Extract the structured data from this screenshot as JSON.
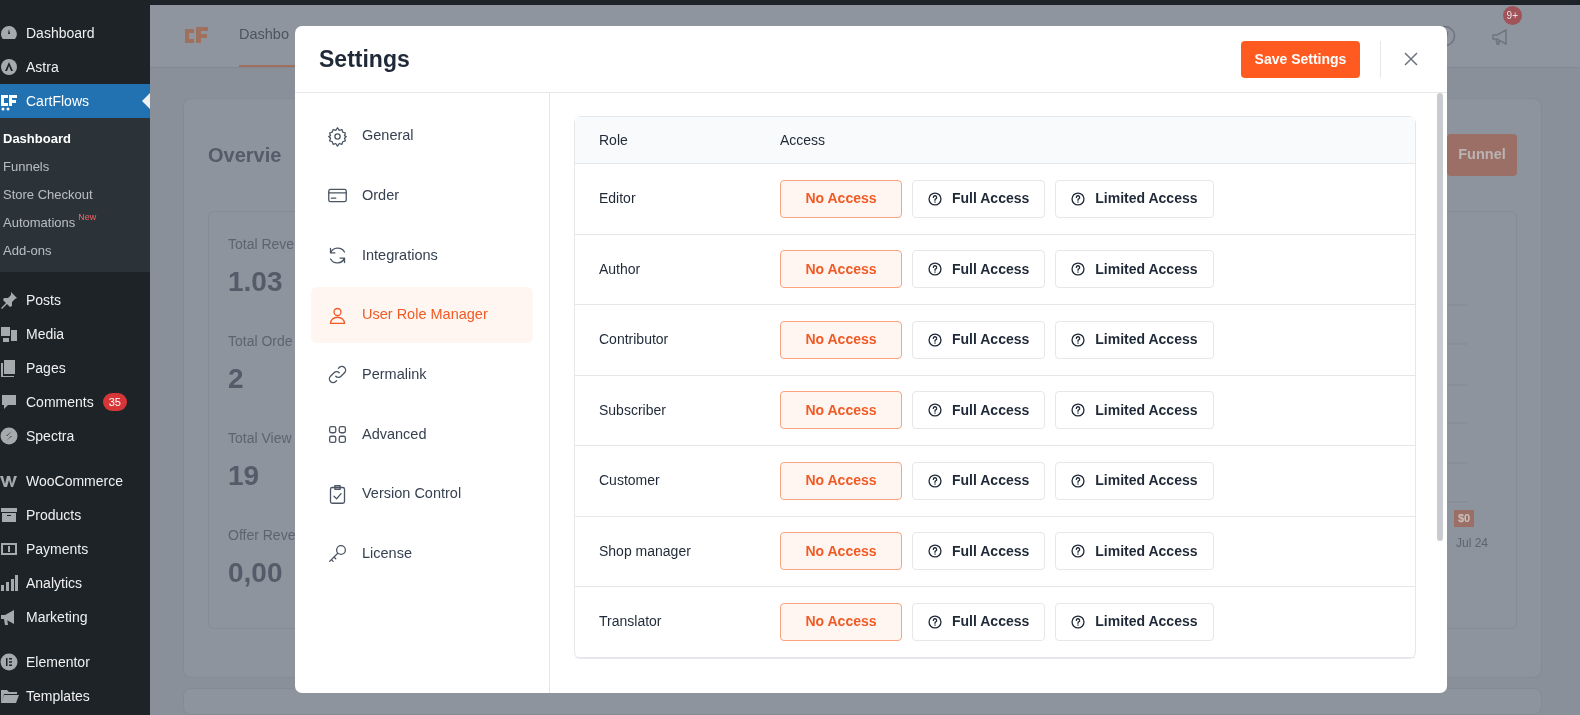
{
  "sidebar": {
    "groups": [
      [
        {
          "label": "Dashboard",
          "selected": false
        },
        {
          "label": "Astra",
          "selected": false
        },
        {
          "label": "CartFlows",
          "selected": true,
          "submenu": [
            {
              "label": "Dashboard",
              "selected": true
            },
            {
              "label": "Funnels",
              "selected": false
            },
            {
              "label": "Store Checkout",
              "selected": false
            },
            {
              "label": "Automations",
              "selected": false,
              "tag": "New"
            },
            {
              "label": "Add-ons",
              "selected": false
            }
          ]
        }
      ],
      [
        {
          "label": "Posts",
          "selected": false
        },
        {
          "label": "Media",
          "selected": false
        },
        {
          "label": "Pages",
          "selected": false
        },
        {
          "label": "Comments",
          "selected": false,
          "badge": "35"
        },
        {
          "label": "Spectra",
          "selected": false
        }
      ],
      [
        {
          "label": "WooCommerce",
          "selected": false
        },
        {
          "label": "Products",
          "selected": false
        },
        {
          "label": "Payments",
          "selected": false
        },
        {
          "label": "Analytics",
          "selected": false
        },
        {
          "label": "Marketing",
          "selected": false
        }
      ],
      [
        {
          "label": "Elementor",
          "selected": false
        },
        {
          "label": "Templates",
          "selected": false
        }
      ]
    ]
  },
  "background": {
    "header": {
      "tab": "Dashbo",
      "notification_badge": "9+"
    },
    "overview": {
      "title": "Overvie",
      "button": "Funnel",
      "stats": [
        {
          "label": "Total Reve",
          "value": "1.03"
        },
        {
          "label": "Total Orde",
          "value": "2"
        },
        {
          "label": "Total View",
          "value": "19"
        },
        {
          "label": "Offer Reve",
          "value": "0,00"
        }
      ],
      "chart_tag": "$0",
      "chart_date": "Jul 24"
    }
  },
  "modal": {
    "title": "Settings",
    "save_button": "Save Settings",
    "nav": [
      {
        "label": "General",
        "selected": false
      },
      {
        "label": "Order",
        "selected": false
      },
      {
        "label": "Integrations",
        "selected": false
      },
      {
        "label": "User Role Manager",
        "selected": true
      },
      {
        "label": "Permalink",
        "selected": false
      },
      {
        "label": "Advanced",
        "selected": false
      },
      {
        "label": "Version Control",
        "selected": false
      },
      {
        "label": "License",
        "selected": false
      }
    ],
    "table": {
      "columns": [
        "Role",
        "Access"
      ],
      "rows": [
        {
          "role": "Editor",
          "options": [
            {
              "label": "No Access",
              "selected": true,
              "help_icon": false
            },
            {
              "label": "Full Access",
              "selected": false,
              "help_icon": true
            },
            {
              "label": "Limited Access",
              "selected": false,
              "help_icon": true
            }
          ]
        },
        {
          "role": "Author",
          "options": [
            {
              "label": "No Access",
              "selected": true,
              "help_icon": false
            },
            {
              "label": "Full Access",
              "selected": false,
              "help_icon": true
            },
            {
              "label": "Limited Access",
              "selected": false,
              "help_icon": true
            }
          ]
        },
        {
          "role": "Contributor",
          "options": [
            {
              "label": "No Access",
              "selected": true,
              "help_icon": false
            },
            {
              "label": "Full Access",
              "selected": false,
              "help_icon": true
            },
            {
              "label": "Limited Access",
              "selected": false,
              "help_icon": true
            }
          ]
        },
        {
          "role": "Subscriber",
          "options": [
            {
              "label": "No Access",
              "selected": true,
              "help_icon": false
            },
            {
              "label": "Full Access",
              "selected": false,
              "help_icon": true
            },
            {
              "label": "Limited Access",
              "selected": false,
              "help_icon": true
            }
          ]
        },
        {
          "role": "Customer",
          "options": [
            {
              "label": "No Access",
              "selected": true,
              "help_icon": false
            },
            {
              "label": "Full Access",
              "selected": false,
              "help_icon": true
            },
            {
              "label": "Limited Access",
              "selected": false,
              "help_icon": true
            }
          ]
        },
        {
          "role": "Shop manager",
          "options": [
            {
              "label": "No Access",
              "selected": true,
              "help_icon": false
            },
            {
              "label": "Full Access",
              "selected": false,
              "help_icon": true
            },
            {
              "label": "Limited Access",
              "selected": false,
              "help_icon": true
            }
          ]
        },
        {
          "role": "Translator",
          "options": [
            {
              "label": "No Access",
              "selected": true,
              "help_icon": false
            },
            {
              "label": "Full Access",
              "selected": false,
              "help_icon": true
            },
            {
              "label": "Limited Access",
              "selected": false,
              "help_icon": true
            }
          ]
        }
      ]
    }
  }
}
